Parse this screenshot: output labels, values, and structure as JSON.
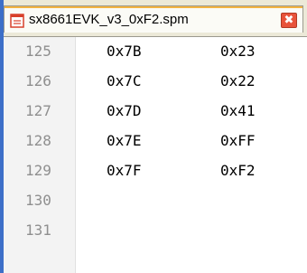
{
  "tab": {
    "title": "sx8661EVK_v3_0xF2.spm",
    "close_symbol": "✖",
    "icon": "document-icon"
  },
  "colors": {
    "tab_highlight": "#f3b341",
    "close_button": "#e8533a",
    "left_accent": "#3d6fc8",
    "line_number": "#8f8f8f"
  },
  "editor": {
    "lines": [
      {
        "num": "125",
        "col1": "0x7B",
        "col2": "0x23"
      },
      {
        "num": "126",
        "col1": "0x7C",
        "col2": "0x22"
      },
      {
        "num": "127",
        "col1": "0x7D",
        "col2": "0x41"
      },
      {
        "num": "128",
        "col1": "0x7E",
        "col2": "0xFF"
      },
      {
        "num": "129",
        "col1": "0x7F",
        "col2": "0xF2"
      },
      {
        "num": "130",
        "col1": "",
        "col2": ""
      },
      {
        "num": "131",
        "col1": "",
        "col2": ""
      }
    ]
  }
}
